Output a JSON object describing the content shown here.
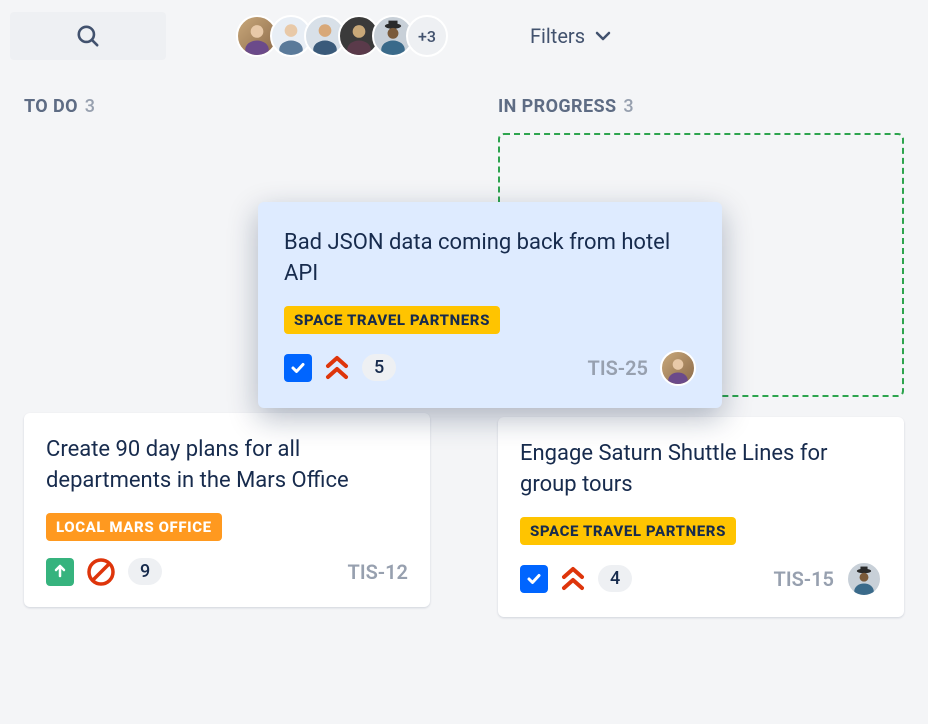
{
  "topbar": {
    "filters_label": "Filters",
    "avatar_overflow": "+3"
  },
  "columns": [
    {
      "title": "TO DO",
      "count": "3",
      "cards": [
        {
          "title": "Create 90 day plans for all departments in the Mars Office",
          "label": "LOCAL MARS OFFICE",
          "label_color": "orange",
          "type": "story",
          "blocked": true,
          "story_points": "9",
          "ticket": "TIS-12"
        }
      ]
    },
    {
      "title": "IN PROGRESS",
      "count": "3",
      "cards": [
        {
          "title": "Engage Saturn Shuttle Lines for group tours",
          "label": "SPACE TRAVEL PARTNERS",
          "label_color": "yellow",
          "type": "task",
          "priority": "highest",
          "story_points": "4",
          "ticket": "TIS-15"
        }
      ]
    }
  ],
  "dragging_card": {
    "title": "Bad JSON data coming back from hotel API",
    "label": "SPACE TRAVEL PARTNERS",
    "label_color": "yellow",
    "type": "task",
    "priority": "highest",
    "story_points": "5",
    "ticket": "TIS-25"
  }
}
